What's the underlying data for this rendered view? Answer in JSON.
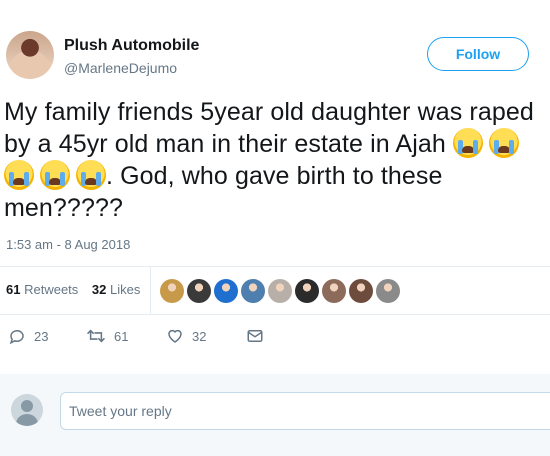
{
  "tweet": {
    "name": "Plush Automobile",
    "handle": "@MarleneDejumo",
    "follow_label": "Follow",
    "text_part1": "My family friends 5year old daughter was raped by a 45yr old man in their estate in Ajah ",
    "text_part2": ". God, who gave birth to these men?????",
    "emoji": "loudly-crying-face",
    "emoji_count": 5,
    "date": "1:53 am - 8 Aug 2018"
  },
  "stats": {
    "retweets_count": "61",
    "retweets_label": "Retweets",
    "likes_count": "32",
    "likes_label": "Likes",
    "liker_colors": [
      "#c79a4a",
      "#3a3a3a",
      "#1f6fd1",
      "#4f7fae",
      "#b8b0a8",
      "#2b2b2b",
      "#8c6b5a",
      "#6d4c3d",
      "#8a8a8a"
    ]
  },
  "actions": {
    "reply_count": "23",
    "retweet_count": "61",
    "like_count": "32"
  },
  "reply": {
    "placeholder": "Tweet your reply"
  },
  "colors": {
    "accent": "#1da1f2",
    "muted": "#657786"
  }
}
